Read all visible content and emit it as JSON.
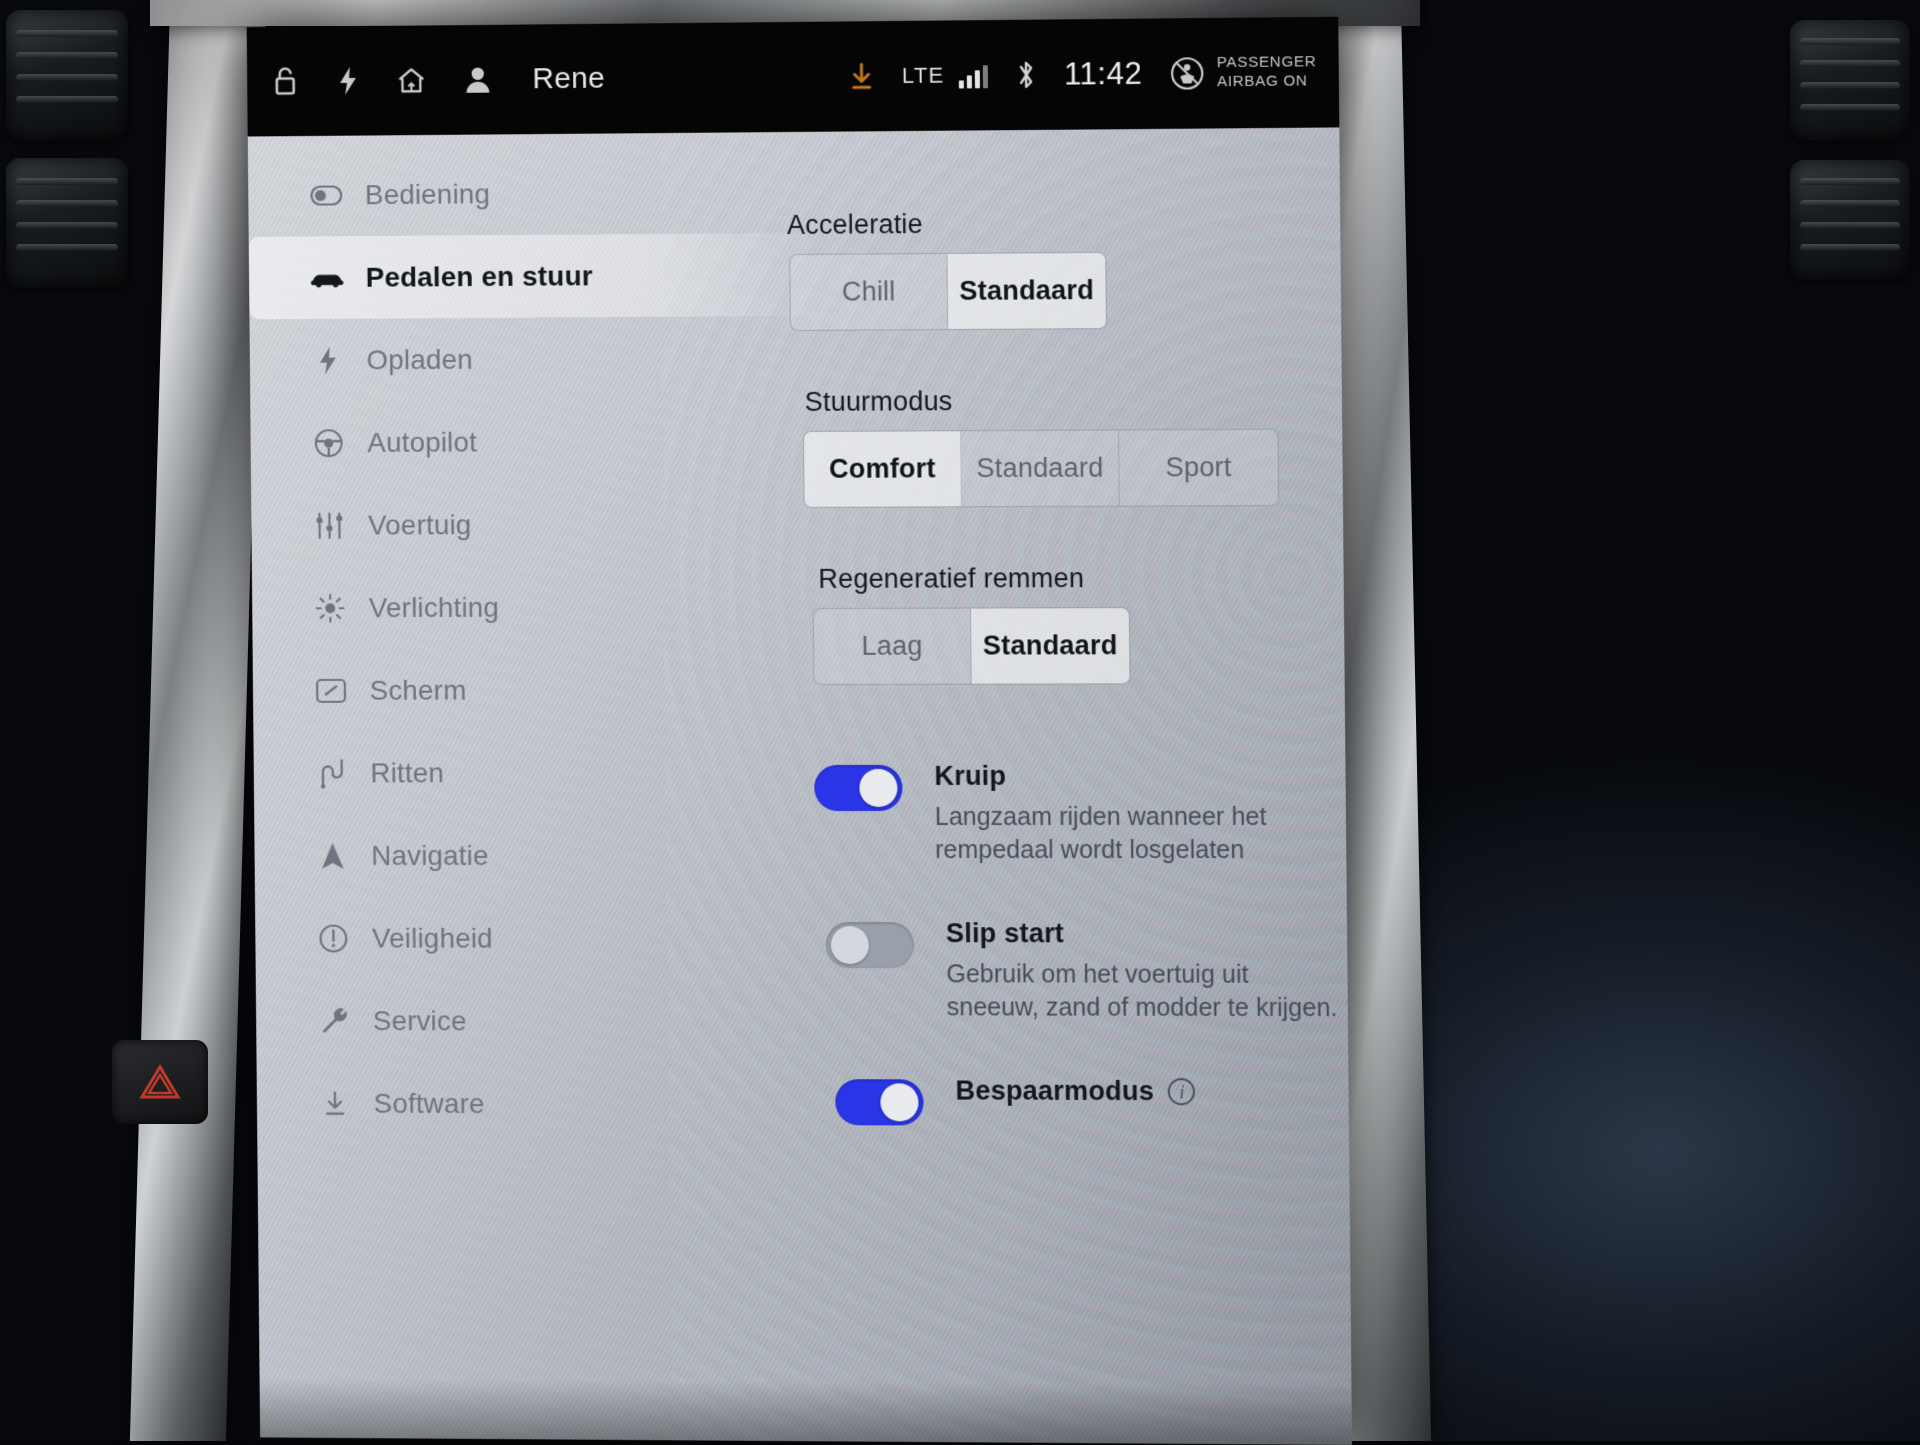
{
  "statusbar": {
    "icons": [
      "unlock-icon",
      "bolt-icon",
      "home-icon",
      "person-icon"
    ],
    "driver_name": "Rene",
    "download_icon": "download-icon",
    "download_color": "#d1821f",
    "network_label": "LTE",
    "signal_bars": 4,
    "bluetooth_icon": "bluetooth-icon",
    "clock": "11:42",
    "airbag_icon": "passenger-airbag-icon",
    "airbag_line1": "PASSENGER",
    "airbag_line2": "AIRBAG ON"
  },
  "sidebar": {
    "items": [
      {
        "label": "Bediening",
        "icon": "toggle-icon",
        "active": false
      },
      {
        "label": "Pedalen en stuur",
        "icon": "car-icon",
        "active": true
      },
      {
        "label": "Opladen",
        "icon": "bolt-icon",
        "active": false
      },
      {
        "label": "Autopilot",
        "icon": "steering-wheel-icon",
        "active": false
      },
      {
        "label": "Voertuig",
        "icon": "sliders-icon",
        "active": false
      },
      {
        "label": "Verlichting",
        "icon": "sun-icon",
        "active": false
      },
      {
        "label": "Scherm",
        "icon": "display-icon",
        "active": false
      },
      {
        "label": "Ritten",
        "icon": "winding-road-icon",
        "active": false
      },
      {
        "label": "Navigatie",
        "icon": "navigation-arrow-icon",
        "active": false
      },
      {
        "label": "Veiligheid",
        "icon": "exclamation-circle-icon",
        "active": false
      },
      {
        "label": "Service",
        "icon": "wrench-icon",
        "active": false
      },
      {
        "label": "Software",
        "icon": "download-icon",
        "active": false
      }
    ]
  },
  "main": {
    "acceleration": {
      "title": "Acceleratie",
      "options": [
        "Chill",
        "Standaard"
      ],
      "selected": "Standaard"
    },
    "steering_mode": {
      "title": "Stuurmodus",
      "options": [
        "Comfort",
        "Standaard",
        "Sport"
      ],
      "selected": "Comfort"
    },
    "regen_braking": {
      "title": "Regeneratief remmen",
      "options": [
        "Laag",
        "Standaard"
      ],
      "selected": "Standaard"
    },
    "toggles": [
      {
        "label": "Kruip",
        "description": "Langzaam rijden wanneer het rempedaal wordt losgelaten",
        "state": "on",
        "has_info": false
      },
      {
        "label": "Slip start",
        "description": "Gebruik om het voertuig uit sneeuw, zand of modder te krijgen.",
        "state": "off",
        "has_info": false
      },
      {
        "label": "Bespaarmodus",
        "description": "",
        "state": "on",
        "has_info": true
      }
    ]
  },
  "colors": {
    "toggle_on": "#2a35e8",
    "accent_orange": "#d1821f",
    "panel_bg": "#c5c8d0",
    "text_dark": "#13161b",
    "text_muted": "#6e7480"
  }
}
